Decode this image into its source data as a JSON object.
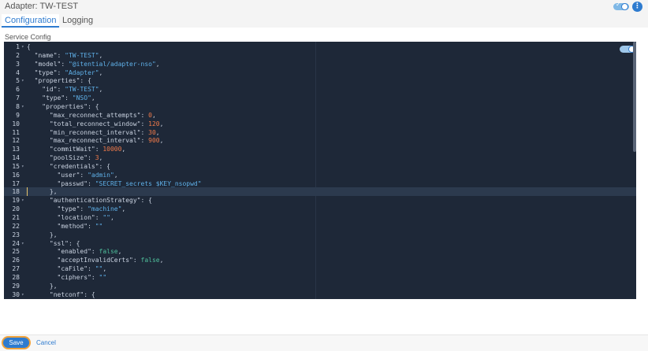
{
  "header": {
    "title": "Adapter: TW-TEST"
  },
  "tabs": [
    {
      "label": "Configuration",
      "active": true
    },
    {
      "label": "Logging",
      "active": false
    }
  ],
  "section_label": "Service Config",
  "editor": {
    "active_line": 18,
    "lines": [
      [
        [
          "k",
          "{"
        ]
      ],
      [
        [
          "k",
          "  \"name\": "
        ],
        [
          "s",
          "\"TW-TEST\""
        ],
        [
          "k",
          ","
        ]
      ],
      [
        [
          "k",
          "  \"model\": "
        ],
        [
          "s",
          "\"@itential/adapter-nso\""
        ],
        [
          "k",
          ","
        ]
      ],
      [
        [
          "k",
          "  \"type\": "
        ],
        [
          "s",
          "\"Adapter\""
        ],
        [
          "k",
          ","
        ]
      ],
      [
        [
          "k",
          "  \"properties\": {"
        ]
      ],
      [
        [
          "k",
          "    \"id\": "
        ],
        [
          "s",
          "\"TW-TEST\""
        ],
        [
          "k",
          ","
        ]
      ],
      [
        [
          "k",
          "    \"type\": "
        ],
        [
          "s",
          "\"NSO\""
        ],
        [
          "k",
          ","
        ]
      ],
      [
        [
          "k",
          "    \"properties\": {"
        ]
      ],
      [
        [
          "k",
          "      \"max_reconnect_attempts\": "
        ],
        [
          "n",
          "0"
        ],
        [
          "k",
          ","
        ]
      ],
      [
        [
          "k",
          "      \"total_reconnect_window\": "
        ],
        [
          "n",
          "120"
        ],
        [
          "k",
          ","
        ]
      ],
      [
        [
          "k",
          "      \"min_reconnect_interval\": "
        ],
        [
          "n",
          "30"
        ],
        [
          "k",
          ","
        ]
      ],
      [
        [
          "k",
          "      \"max_reconnect_interval\": "
        ],
        [
          "n",
          "900"
        ],
        [
          "k",
          ","
        ]
      ],
      [
        [
          "k",
          "      \"commitWait\": "
        ],
        [
          "n",
          "10000"
        ],
        [
          "k",
          ","
        ]
      ],
      [
        [
          "k",
          "      \"poolSize\": "
        ],
        [
          "n",
          "3"
        ],
        [
          "k",
          ","
        ]
      ],
      [
        [
          "k",
          "      \"credentials\": {"
        ]
      ],
      [
        [
          "k",
          "        \"user\": "
        ],
        [
          "s",
          "\"admin\""
        ],
        [
          "k",
          ","
        ]
      ],
      [
        [
          "k",
          "        \"passwd\": "
        ],
        [
          "s",
          "\"SECRET_secrets $KEY_nsopwd\""
        ]
      ],
      [
        [
          "k",
          "      },"
        ]
      ],
      [
        [
          "k",
          "      \"authenticationStrategy\": {"
        ]
      ],
      [
        [
          "k",
          "        \"type\": "
        ],
        [
          "s",
          "\"machine\""
        ],
        [
          "k",
          ","
        ]
      ],
      [
        [
          "k",
          "        \"location\": "
        ],
        [
          "s",
          "\"\""
        ],
        [
          "k",
          ","
        ]
      ],
      [
        [
          "k",
          "        \"method\": "
        ],
        [
          "s",
          "\"\""
        ]
      ],
      [
        [
          "k",
          "      },"
        ]
      ],
      [
        [
          "k",
          "      \"ssl\": {"
        ]
      ],
      [
        [
          "k",
          "        \"enabled\": "
        ],
        [
          "b",
          "false"
        ],
        [
          "k",
          ","
        ]
      ],
      [
        [
          "k",
          "        \"acceptInvalidCerts\": "
        ],
        [
          "b",
          "false"
        ],
        [
          "k",
          ","
        ]
      ],
      [
        [
          "k",
          "        \"caFile\": "
        ],
        [
          "s",
          "\"\""
        ],
        [
          "k",
          ","
        ]
      ],
      [
        [
          "k",
          "        \"ciphers\": "
        ],
        [
          "s",
          "\"\""
        ]
      ],
      [
        [
          "k",
          "      },"
        ]
      ],
      [
        [
          "k",
          "      \"netconf\": {"
        ]
      ]
    ],
    "fold_lines": [
      1,
      5,
      8,
      15,
      19,
      24,
      30
    ]
  },
  "footer": {
    "save_label": "Save",
    "cancel_label": "Cancel"
  }
}
